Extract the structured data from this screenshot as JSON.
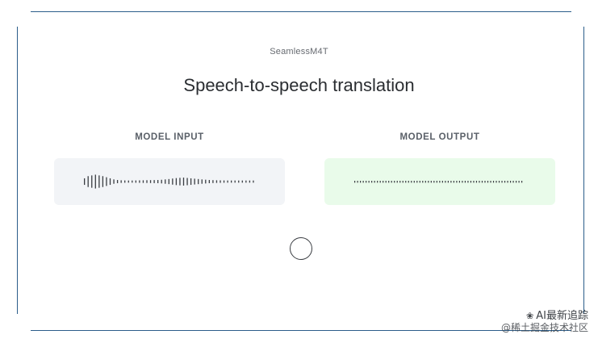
{
  "header": {
    "product_name": "SeamlessM4T",
    "title": "Speech-to-speech translation"
  },
  "input_panel": {
    "label": "MODEL INPUT",
    "background": "#f2f4f7",
    "waveform_color": "#3a3d42",
    "waveform_levels": [
      0.45,
      0.75,
      0.85,
      0.95,
      0.85,
      0.75,
      0.6,
      0.45,
      0.3,
      0.22,
      0.18,
      0.16,
      0.15,
      0.15,
      0.16,
      0.17,
      0.18,
      0.19,
      0.2,
      0.21,
      0.22,
      0.25,
      0.3,
      0.35,
      0.42,
      0.48,
      0.52,
      0.55,
      0.5,
      0.45,
      0.4,
      0.35,
      0.3,
      0.26,
      0.22,
      0.2,
      0.18,
      0.17,
      0.16,
      0.15,
      0.15,
      0.15,
      0.15,
      0.15,
      0.15,
      0.15,
      0.15
    ]
  },
  "output_panel": {
    "label": "MODEL OUTPUT",
    "background": "#e9fbea",
    "waveform_color": "#3a3d42",
    "dot_count": 60
  },
  "controls": {
    "record_button": "record-circle"
  },
  "watermark": {
    "line1": "AI最新追踪",
    "line2": "@稀土掘金技术社区"
  },
  "colors": {
    "frame": "#2b5d8a",
    "title": "#2a2d31"
  }
}
